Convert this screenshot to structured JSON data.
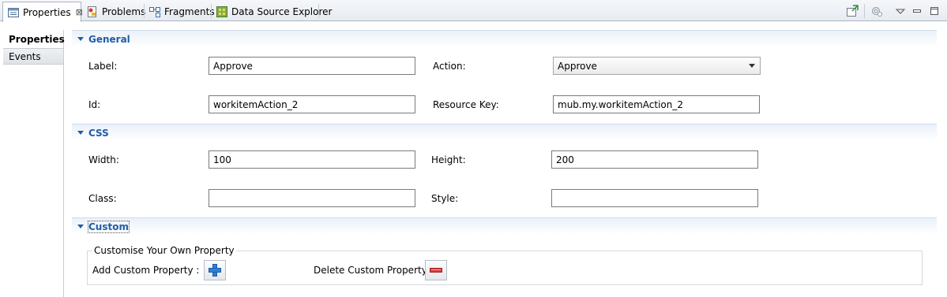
{
  "tabs": [
    {
      "label": "Properties",
      "icon": "properties-icon",
      "active": true,
      "closable": true
    },
    {
      "label": "Problems",
      "icon": "problems-icon"
    },
    {
      "label": "Fragments",
      "icon": "fragments-icon"
    },
    {
      "label": "Data Source Explorer",
      "icon": "data-source-explorer-icon"
    }
  ],
  "close_glyph": "⊠",
  "sidebar": {
    "items": [
      {
        "label": "Properties",
        "selected": true
      },
      {
        "label": "Events",
        "selected": false
      }
    ]
  },
  "sections": {
    "general": {
      "title": "General",
      "label_label": "Label:",
      "label_value": "Approve",
      "action_label": "Action:",
      "action_value": "Approve",
      "id_label": "Id:",
      "id_value": "workitemAction_2",
      "resource_key_label": "Resource Key:",
      "resource_key_value": "mub.my.workitemAction_2"
    },
    "css": {
      "title": "CSS",
      "width_label": "Width:",
      "width_value": "100",
      "height_label": "Height:",
      "height_value": "200",
      "class_label": "Class:",
      "class_value": "",
      "style_label": "Style:",
      "style_value": ""
    },
    "custom": {
      "title": "Custom",
      "group_title": "Customise Your Own Property",
      "add_label": "Add Custom Property :",
      "delete_label": "Delete Custom Property :"
    }
  },
  "colors": {
    "section_title": "#1f5da6",
    "add_icon": "#2f7fd6",
    "delete_icon": "#d83a3a"
  }
}
